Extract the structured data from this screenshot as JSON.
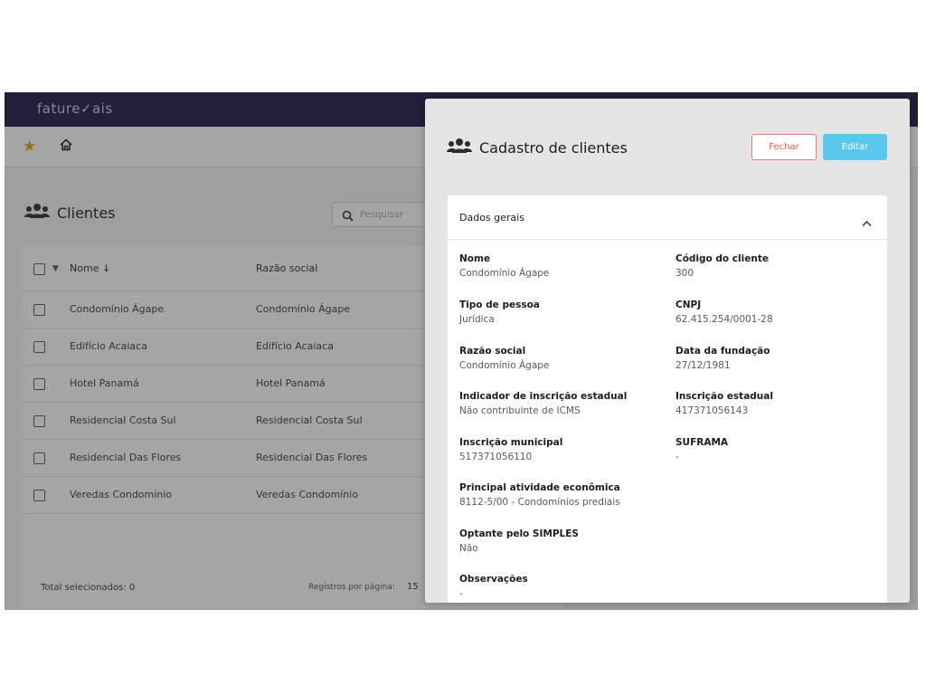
{
  "app": {
    "brand": "fature✓ais"
  },
  "page": {
    "title": "Clientes",
    "search_placeholder": "Pesquisar"
  },
  "table": {
    "columns": [
      "Nome ↓",
      "Razão social"
    ],
    "rows": [
      {
        "nome": "Condomínio Ágape",
        "razao": "Condomínio Ágape"
      },
      {
        "nome": "Edifício Acaiaca",
        "razao": "Edifício Acaiaca"
      },
      {
        "nome": "Hotel Panamá",
        "razao": "Hotel Panamá"
      },
      {
        "nome": "Residencial Costa Sul",
        "razao": "Residencial Costa Sul"
      },
      {
        "nome": "Residencial Das Flores",
        "razao": "Residencial Das Flores"
      },
      {
        "nome": "Veredas Condomínio",
        "razao": "Veredas Condomínio"
      }
    ],
    "footer": {
      "selected": "Total selecionados: 0",
      "rows_per_page_label": "Registros por página:",
      "rows_per_page_value": "15"
    }
  },
  "modal": {
    "title": "Cadastro de clientes",
    "close_label": "Fechar",
    "edit_label": "Editar",
    "section_title": "Dados gerais",
    "fields": {
      "nome": {
        "label": "Nome",
        "value": "Condomínio Ágape"
      },
      "codigo": {
        "label": "Código do cliente",
        "value": "300"
      },
      "tipo": {
        "label": "Tipo de pessoa",
        "value": "Jurídica"
      },
      "cnpj": {
        "label": "CNPJ",
        "value": "62.415.254/0001-28"
      },
      "razao": {
        "label": "Razão social",
        "value": "Condomínio Ágape"
      },
      "fundacao": {
        "label": "Data da fundação",
        "value": "27/12/1981"
      },
      "indicador": {
        "label": "Indicador de inscrição estadual",
        "value": "Não contribuinte de ICMS"
      },
      "ie": {
        "label": "Inscrição estadual",
        "value": "417371056143"
      },
      "im": {
        "label": "Inscrição municipal",
        "value": "517371056110"
      },
      "suframa": {
        "label": "SUFRAMA",
        "value": "-"
      },
      "atividade": {
        "label": "Principal atividade econômica",
        "value": "8112-5/00 - Condomínios prediais"
      },
      "simples": {
        "label": "Optante pelo SIMPLES",
        "value": "Não"
      },
      "obs": {
        "label": "Observações",
        "value": "-"
      }
    }
  },
  "colors": {
    "topbar": "#1a1a4a",
    "star": "#e8a317",
    "edit_button": "#5ac8ec",
    "close_button": "#e35d5d"
  }
}
